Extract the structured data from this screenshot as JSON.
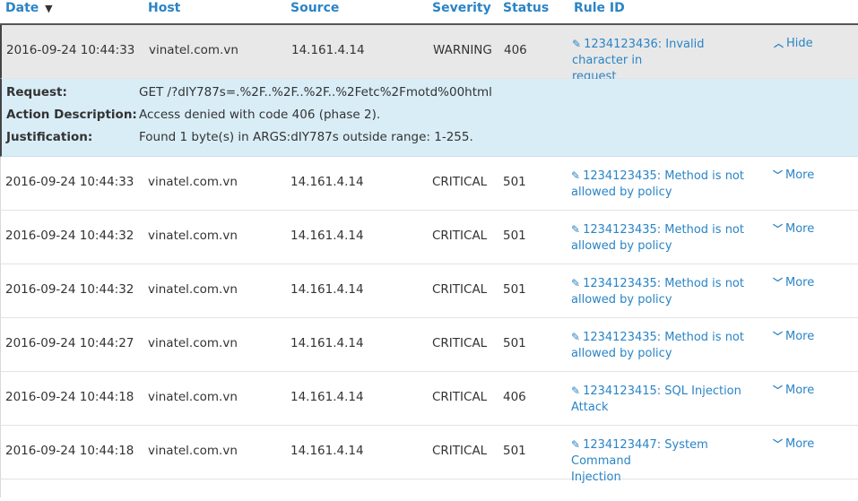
{
  "columns": {
    "date": "Date",
    "sort_indicator": "▼",
    "host": "Host",
    "source": "Source",
    "severity": "Severity",
    "status": "Status",
    "rule_id": "Rule ID"
  },
  "rows": [
    {
      "date": "2016-09-24 10:44:33",
      "host": "vinatel.com.vn",
      "source": "14.161.4.14",
      "severity": "WARNING",
      "status": "406",
      "rule_line1": "1234123436: Invalid character in",
      "rule_line2": "request",
      "toggle": "Hide"
    },
    {
      "date": "2016-09-24 10:44:33",
      "host": "vinatel.com.vn",
      "source": "14.161.4.14",
      "severity": "CRITICAL",
      "status": "501",
      "rule_line1": "1234123435: Method is not",
      "rule_line2": "allowed by policy",
      "toggle": "More"
    },
    {
      "date": "2016-09-24 10:44:32",
      "host": "vinatel.com.vn",
      "source": "14.161.4.14",
      "severity": "CRITICAL",
      "status": "501",
      "rule_line1": "1234123435: Method is not",
      "rule_line2": "allowed by policy",
      "toggle": "More"
    },
    {
      "date": "2016-09-24 10:44:32",
      "host": "vinatel.com.vn",
      "source": "14.161.4.14",
      "severity": "CRITICAL",
      "status": "501",
      "rule_line1": "1234123435: Method is not",
      "rule_line2": "allowed by policy",
      "toggle": "More"
    },
    {
      "date": "2016-09-24 10:44:27",
      "host": "vinatel.com.vn",
      "source": "14.161.4.14",
      "severity": "CRITICAL",
      "status": "501",
      "rule_line1": "1234123435: Method is not",
      "rule_line2": "allowed by policy",
      "toggle": "More"
    },
    {
      "date": "2016-09-24 10:44:18",
      "host": "vinatel.com.vn",
      "source": "14.161.4.14",
      "severity": "CRITICAL",
      "status": "406",
      "rule_line1": "1234123415: SQL Injection",
      "rule_line2": "Attack",
      "toggle": "More"
    },
    {
      "date": "2016-09-24 10:44:18",
      "host": "vinatel.com.vn",
      "source": "14.161.4.14",
      "severity": "CRITICAL",
      "status": "501",
      "rule_line1": "1234123447: System Command",
      "rule_line2": "Injection",
      "toggle": "More"
    }
  ],
  "detail": {
    "request_label": "Request:",
    "request_value": "GET /?dIY787s=.%2F..%2F..%2F..%2Fetc%2Fmotd%00html",
    "action_label": "Action Description:",
    "action_value": "Access denied with code 406 (phase 2).",
    "justification_label": "Justification:",
    "justification_value": "Found 1 byte(s) in ARGS:dIY787s outside range: 1-255."
  },
  "icons": {
    "edit": "pencil-icon",
    "expand": "chevron-down-icon",
    "collapse": "chevron-up-icon"
  },
  "colors": {
    "link": "#2a84c6",
    "selected_row": "#e8e8e8",
    "detail_bg": "#d9edf7"
  }
}
